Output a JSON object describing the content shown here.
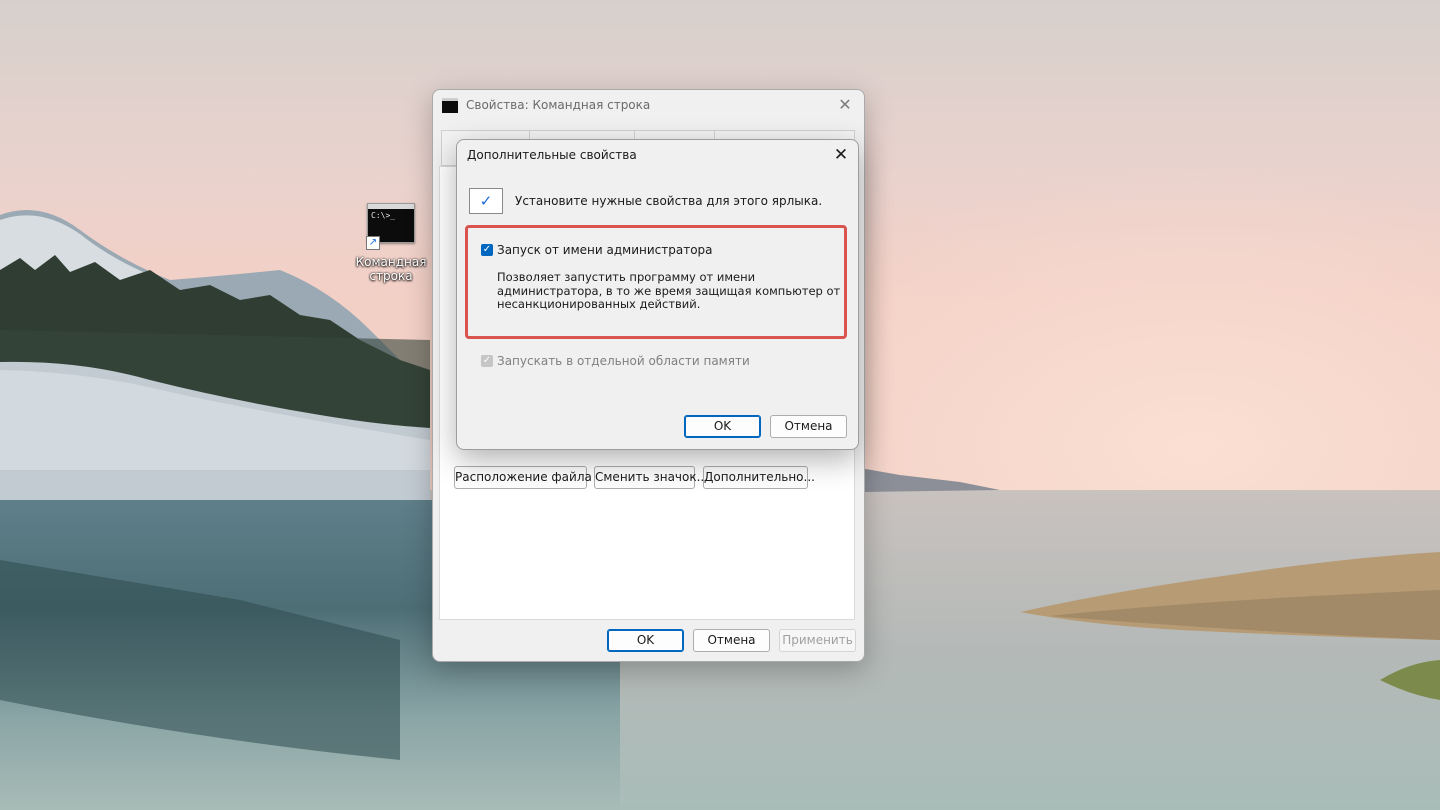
{
  "desktop": {
    "icon": {
      "label": "Командная строка",
      "icon": "cmd-icon",
      "prompt": "C:\\>_"
    }
  },
  "main_window": {
    "title": "Свойства: Командная строка",
    "icon": "cmd-icon",
    "buttons": {
      "file_location": "Расположение файла",
      "change_icon": "Сменить значок...",
      "advanced": "Дополнительно..."
    },
    "footer": {
      "ok": "OK",
      "cancel": "Отмена",
      "apply": "Применить"
    }
  },
  "advanced_dialog": {
    "title": "Дополнительные свойства",
    "header_text": "Установите нужные свойства для этого ярлыка.",
    "run_as_admin": {
      "label": "Запуск от имени администратора",
      "checked": true,
      "description": "Позволяет запустить программу от имени администратора, в то же время защищая компьютер от несанкционированных действий."
    },
    "separate_memory": {
      "label": "Запускать в отдельной области памяти",
      "checked": true,
      "disabled": true
    },
    "ok": "OK",
    "cancel": "Отмена",
    "highlight_color": "#d9534f",
    "accent_color": "#0067c0"
  }
}
